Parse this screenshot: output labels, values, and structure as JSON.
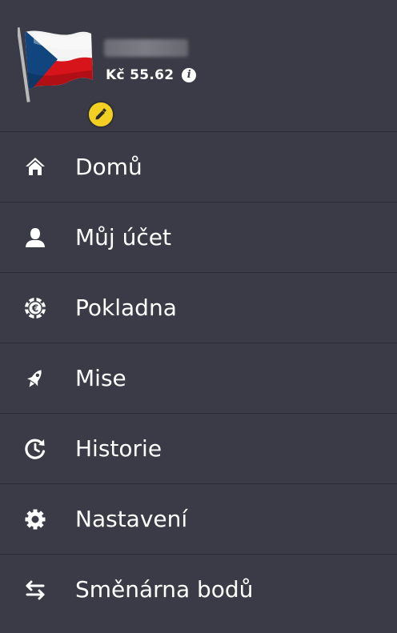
{
  "profile": {
    "balance": "Kč 55.62",
    "info_glyph": "i",
    "avatar": "czech-flag",
    "badge_icon": "pencil-icon"
  },
  "menu": {
    "items": [
      {
        "label": "Domů",
        "icon": "home-icon"
      },
      {
        "label": "Můj účet",
        "icon": "user-icon"
      },
      {
        "label": "Pokladna",
        "icon": "chip-icon"
      },
      {
        "label": "Mise",
        "icon": "rocket-icon"
      },
      {
        "label": "Historie",
        "icon": "history-icon"
      },
      {
        "label": "Nastavení",
        "icon": "gear-icon"
      },
      {
        "label": "Směnárna bodů",
        "icon": "exchange-icon"
      }
    ]
  },
  "colors": {
    "background": "#3a3b46",
    "divider": "#2a2b33",
    "text": "#ffffff",
    "badge": "#f2cf21"
  }
}
